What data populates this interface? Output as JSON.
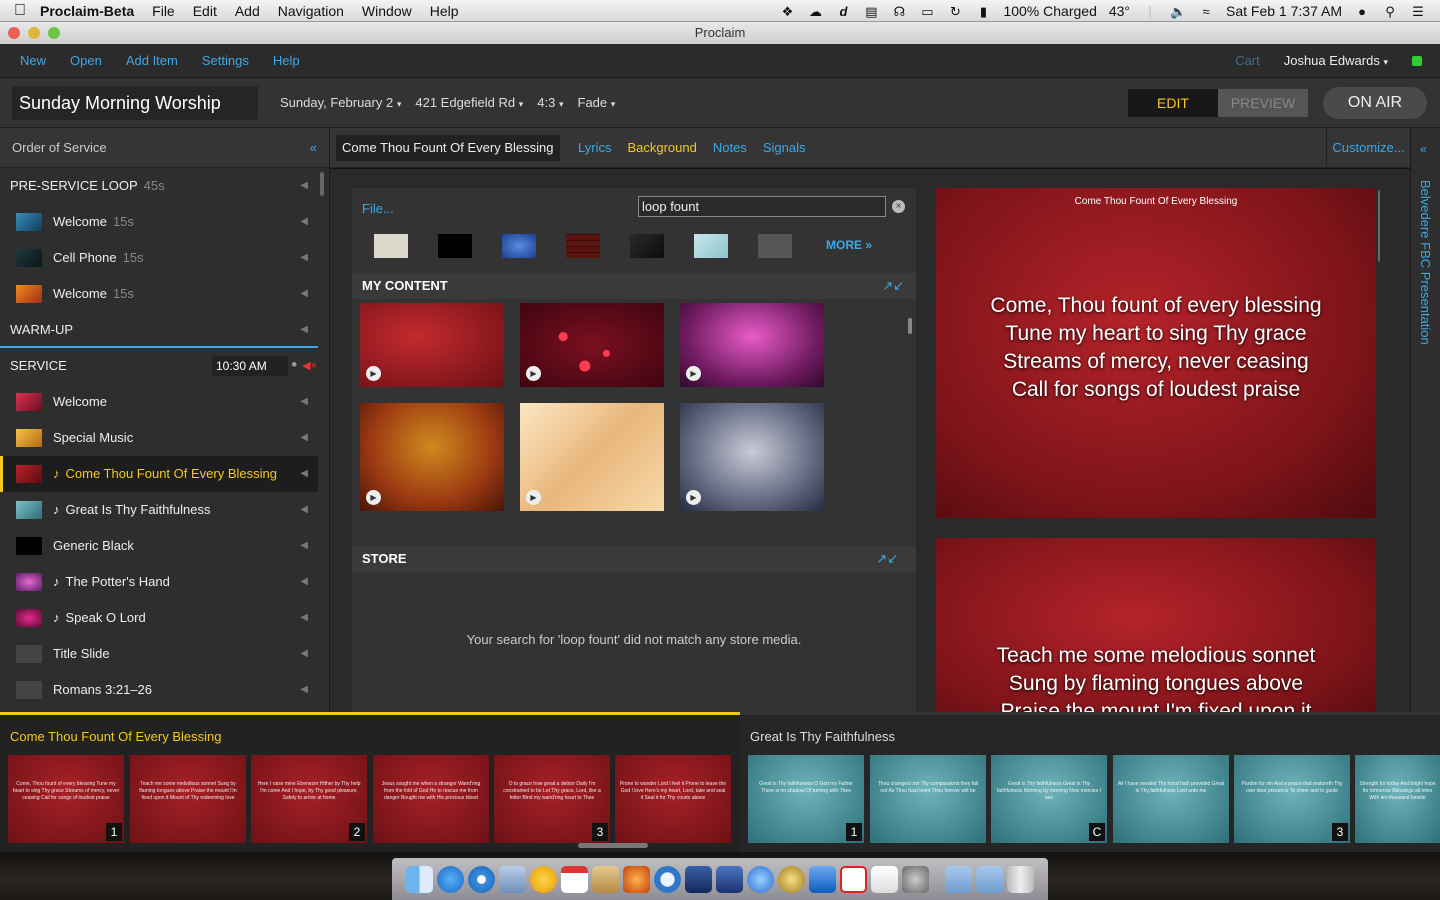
{
  "menubar": {
    "app_name": "Proclaim-Beta",
    "menus": [
      "File",
      "Edit",
      "Add",
      "Navigation",
      "Window",
      "Help"
    ],
    "battery": "100% Charged",
    "temperature": "43°",
    "datetime": "Sat Feb 1   7:37 AM"
  },
  "window": {
    "title": "Proclaim"
  },
  "toolbar": {
    "items": [
      "New",
      "Open",
      "Add Item",
      "Settings",
      "Help"
    ],
    "cart": "Cart",
    "user": "Joshua Edwards"
  },
  "service": {
    "title": "Sunday Morning Worship",
    "date": "Sunday, February 2",
    "location": "421 Edgefield Rd",
    "aspect": "4:3",
    "transition": "Fade",
    "mode_edit": "EDIT",
    "mode_preview": "PREVIEW",
    "on_air": "ON AIR"
  },
  "sidebar": {
    "header": "Order of Service",
    "preservice": {
      "label": "PRE-SERVICE LOOP",
      "duration": "45s"
    },
    "preservice_items": [
      {
        "label": "Welcome",
        "duration": "15s"
      },
      {
        "label": "Cell Phone",
        "duration": "15s"
      },
      {
        "label": "Welcome",
        "duration": "15s"
      }
    ],
    "warmup": "WARM-UP",
    "service_label": "SERVICE",
    "service_time": "10:30 AM",
    "items": [
      {
        "label": "Welcome"
      },
      {
        "label": "Special Music"
      },
      {
        "label": "Come Thou Fount Of Every Blessing",
        "note": "♪"
      },
      {
        "label": "Great Is Thy Faithfulness",
        "note": "♪"
      },
      {
        "label": "Generic Black"
      },
      {
        "label": "The Potter's Hand",
        "note": "♪"
      },
      {
        "label": "Speak O Lord",
        "note": "♪"
      },
      {
        "label": "Title Slide"
      },
      {
        "label": "Romans 3:21–26"
      }
    ]
  },
  "item_editor": {
    "item_name": "Come Thou Fount Of Every Blessing",
    "tabs": [
      "Lyrics",
      "Background",
      "Notes",
      "Signals"
    ],
    "active_tab": "Background",
    "customize": "Customize...",
    "presentation": "Belvedere FBC Presentation"
  },
  "background": {
    "file_link": "File...",
    "search_value": "loop fount",
    "more_link": "MORE »",
    "my_content_label": "MY CONTENT",
    "store_label": "STORE",
    "store_message": "Your search for 'loop fount' did not match any store media."
  },
  "slides_preview": {
    "slide1_title": "Come Thou Fount Of Every Blessing",
    "slide1_lines": [
      "Come, Thou fount of every blessing",
      "Tune my heart to sing Thy grace",
      "Streams of mercy, never ceasing",
      "Call for songs of loudest praise"
    ],
    "slide2_lines": [
      "Teach me some melodious sonnet",
      "Sung by flaming tongues above",
      "Praise the mount I'm fixed upon it"
    ]
  },
  "filmstrip": {
    "group1_title": "Come Thou Fount Of Every Blessing",
    "group1_slides": [
      {
        "text": "Come, Thou fount of every blessing Tune my heart to sing Thy grace Streams of mercy, never ceasing Call for songs of loudest praise",
        "num": "1"
      },
      {
        "text": "Teach me some melodious sonnet Sung by flaming tongues above Praise the mount I'm fixed upon it Mount of Thy redeeming love",
        "num": ""
      },
      {
        "text": "Here I raise mine Ebenezer Hither by Thy help I'm come And I hope, by Thy good pleasure, Safely to arrive at home",
        "num": "2"
      },
      {
        "text": "Jesus sought me when a stranger Wand'ring from the fold of God He to rescue me from danger Bought me with His precious blood",
        "num": ""
      },
      {
        "text": "O to grace how great a debtor Daily I'm constrained to be Let Thy grace, Lord, like a fetter Bind my wand'ring heart to Thee",
        "num": "3"
      },
      {
        "text": "Prone to wander Lord I feel it Prone to leave the God I love Here's my heart, Lord, take and seal it Seal it for Thy courts above",
        "num": ""
      }
    ],
    "group2_title": "Great Is Thy Faithfulness",
    "group2_slides": [
      {
        "text": "Great is Thy faithfulness O God my Father There is no shadow Of turning with Thee",
        "num": "1"
      },
      {
        "text": "Thou changest not Thy compassions they fail not As Thou hast been Thou forever wilt be",
        "num": ""
      },
      {
        "text": "Great is Thy faithfulness Great is Thy faithfulness Morning by morning New mercies I see",
        "num": "C"
      },
      {
        "text": "All I have needed Thy hand hath provided Great is Thy faithfulness Lord unto me",
        "num": ""
      },
      {
        "text": "Pardon for sin And a peace that endureth Thy own dear presence To cheer and to guide",
        "num": "3"
      },
      {
        "text": "Strength for today And bright hope for tomorrow Blessings all mine With ten thousand beside",
        "num": ""
      }
    ]
  },
  "colors": {
    "accent_blue": "#3ba9e8",
    "accent_yellow": "#f4c91e",
    "mute_red": "#e33333"
  }
}
